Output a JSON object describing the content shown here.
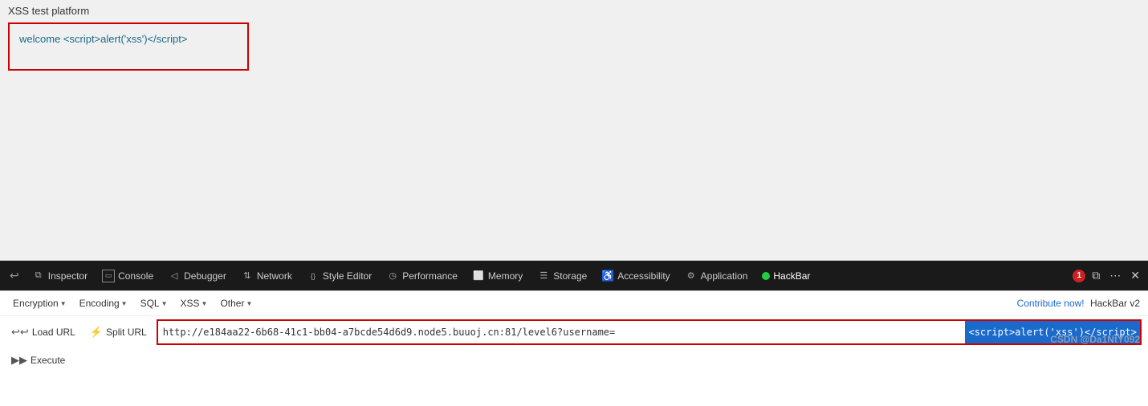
{
  "page": {
    "title": "XSS test platform"
  },
  "content": {
    "welcome_text": "welcome <script>alert('xss')</script>"
  },
  "devtools": {
    "tabs": [
      {
        "id": "inspector",
        "label": "Inspector",
        "icon": "inspector-icon",
        "active": false
      },
      {
        "id": "console",
        "label": "Console",
        "icon": "console-icon",
        "active": false
      },
      {
        "id": "debugger",
        "label": "Debugger",
        "icon": "debugger-icon",
        "active": false
      },
      {
        "id": "network",
        "label": "Network",
        "icon": "network-icon",
        "active": false
      },
      {
        "id": "style-editor",
        "label": "Style Editor",
        "icon": "style-icon",
        "active": false
      },
      {
        "id": "performance",
        "label": "Performance",
        "icon": "perf-icon",
        "active": false
      },
      {
        "id": "memory",
        "label": "Memory",
        "icon": "memory-icon",
        "active": false
      },
      {
        "id": "storage",
        "label": "Storage",
        "icon": "storage-icon",
        "active": false
      },
      {
        "id": "accessibility",
        "label": "Accessibility",
        "icon": "accessibility-icon",
        "active": false
      },
      {
        "id": "application",
        "label": "Application",
        "icon": "application-icon",
        "active": false
      },
      {
        "id": "hackbar",
        "label": "HackBar",
        "icon": "hackbar-icon",
        "active": true
      }
    ],
    "error_count": "1",
    "responsive_icon": "responsive-icon",
    "more_icon": "more-icon",
    "close_icon": "close-icon"
  },
  "hackbar": {
    "menus": [
      {
        "id": "encryption",
        "label": "Encryption",
        "has_dropdown": true
      },
      {
        "id": "encoding",
        "label": "Encoding",
        "has_dropdown": true
      },
      {
        "id": "sql",
        "label": "SQL",
        "has_dropdown": true
      },
      {
        "id": "xss",
        "label": "XSS",
        "has_dropdown": true
      },
      {
        "id": "other",
        "label": "Other",
        "has_dropdown": true
      }
    ],
    "contribute_text": "Contribute now!",
    "version_text": "HackBar v2",
    "load_url_label": "Load URL",
    "split_url_label": "Split URL",
    "execute_label": "Execute",
    "url_value": "http://e184aa22-6b68-41c1-bb04-a7bcde54d6d9.node5.buuoj.cn:81/level6?username=",
    "url_highlight": "<script>alert('xss')</script>",
    "watermark": "CSDN @Da1NtY092"
  }
}
